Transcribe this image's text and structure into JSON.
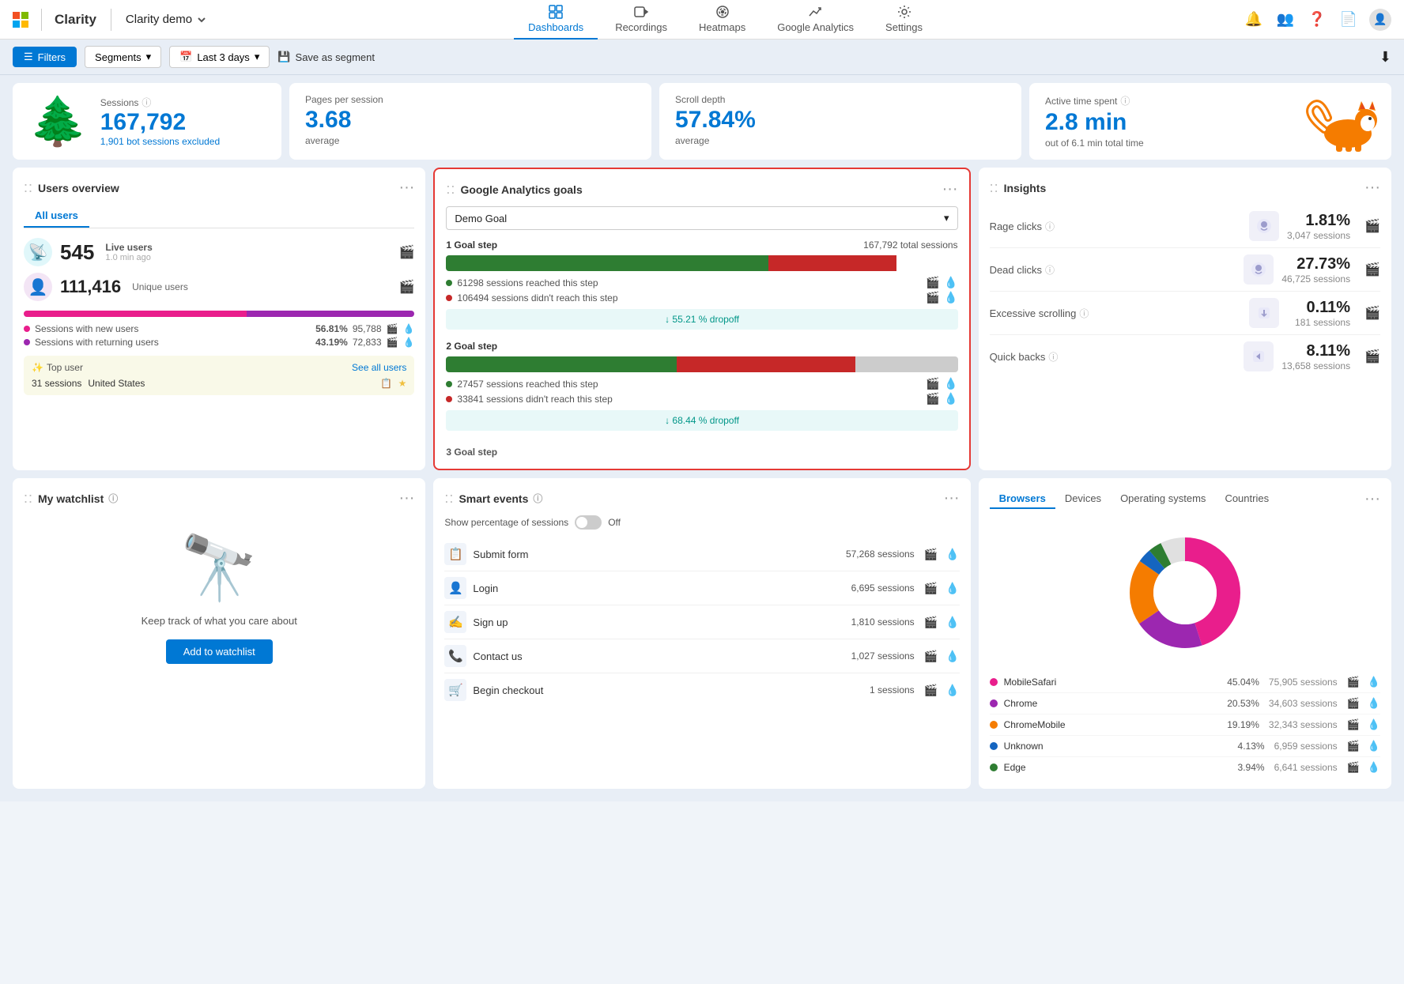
{
  "nav": {
    "brand": "Clarity",
    "project": "Clarity demo",
    "items": [
      {
        "id": "dashboards",
        "label": "Dashboards",
        "active": true
      },
      {
        "id": "recordings",
        "label": "Recordings",
        "active": false
      },
      {
        "id": "heatmaps",
        "label": "Heatmaps",
        "active": false
      },
      {
        "id": "google-analytics",
        "label": "Google Analytics",
        "active": false
      },
      {
        "id": "settings",
        "label": "Settings",
        "active": false
      }
    ]
  },
  "filterbar": {
    "filters_label": "Filters",
    "segments_label": "Segments",
    "lastdays_label": "Last 3 days",
    "save_label": "Save as segment"
  },
  "stats": {
    "sessions": {
      "label": "Sessions",
      "value": "167,792",
      "sub": "1,901 bot sessions excluded"
    },
    "pages_per_session": {
      "label": "Pages per session",
      "value": "3.68",
      "avg": "average"
    },
    "scroll_depth": {
      "label": "Scroll depth",
      "value": "57.84%",
      "avg": "average"
    },
    "active_time": {
      "label": "Active time spent",
      "value": "2.8 min",
      "sub": "out of 6.1 min total time"
    }
  },
  "users_overview": {
    "title": "Users overview",
    "tab_all_users": "All users",
    "live_users": {
      "value": "545",
      "label": "Live users",
      "sub": "1.0 min ago"
    },
    "unique_users": {
      "value": "111,416",
      "label": "Unique users"
    },
    "sessions_new": {
      "label": "Sessions with new users",
      "pct": "56.81%",
      "count": "95,788"
    },
    "sessions_returning": {
      "label": "Sessions with returning users",
      "pct": "43.19%",
      "count": "72,833"
    },
    "top_user": {
      "label": "Top user",
      "see_all": "See all users",
      "sessions": "31 sessions",
      "location": "United States"
    }
  },
  "ga_goals": {
    "title": "Google Analytics goals",
    "dropdown_value": "Demo Goal",
    "goal1": {
      "step": "1 Goal step",
      "total": "167,792 total sessions",
      "green_pct": 63,
      "red_pct": 25,
      "reached": "61298 sessions reached this step",
      "not_reached": "106494 sessions didn't reach this step",
      "dropoff": "55.21 % dropoff"
    },
    "goal2": {
      "step": "2 Goal step",
      "green_pct": 45,
      "red_pct": 35,
      "gray_pct": 20,
      "reached": "27457 sessions reached this step",
      "not_reached": "33841 sessions didn't reach this step",
      "dropoff": "68.44 % dropoff"
    },
    "goal3_label": "3 Goal step"
  },
  "insights": {
    "title": "Insights",
    "rage_clicks": {
      "label": "Rage clicks",
      "pct": "1.81%",
      "sessions": "3,047 sessions"
    },
    "dead_clicks": {
      "label": "Dead clicks",
      "pct": "27.73%",
      "sessions": "46,725 sessions"
    },
    "excessive_scrolling": {
      "label": "Excessive scrolling",
      "pct": "0.11%",
      "sessions": "181 sessions"
    },
    "quick_backs": {
      "label": "Quick backs",
      "pct": "8.11%",
      "sessions": "13,658 sessions"
    }
  },
  "watchlist": {
    "title": "My watchlist",
    "description": "Keep track of what you care about",
    "add_button": "Add to watchlist"
  },
  "smart_events": {
    "title": "Smart events",
    "toggle_label": "Show percentage of sessions",
    "toggle_value": "Off",
    "events": [
      {
        "name": "Submit form",
        "sessions": "57,268 sessions"
      },
      {
        "name": "Login",
        "sessions": "6,695 sessions"
      },
      {
        "name": "Sign up",
        "sessions": "1,810 sessions"
      },
      {
        "name": "Contact us",
        "sessions": "1,027 sessions"
      },
      {
        "name": "Begin checkout",
        "sessions": "1 sessions"
      }
    ]
  },
  "browsers": {
    "tabs": [
      "Browsers",
      "Devices",
      "Operating systems",
      "Countries"
    ],
    "active_tab": "Browsers",
    "chart": {
      "segments": [
        {
          "label": "MobileSafari",
          "pct": 45.04,
          "color": "#e91e8c"
        },
        {
          "label": "Chrome",
          "pct": 20.53,
          "color": "#9c27b0"
        },
        {
          "label": "ChromeMobile",
          "pct": 19.19,
          "color": "#f57c00"
        },
        {
          "label": "Unknown",
          "pct": 4.13,
          "color": "#1565c0"
        },
        {
          "label": "Edge",
          "pct": 3.94,
          "color": "#2e7d32"
        }
      ]
    },
    "rows": [
      {
        "name": "MobileSafari",
        "pct": "45.04%",
        "sessions": "75,905 sessions",
        "color": "#e91e8c"
      },
      {
        "name": "Chrome",
        "pct": "20.53%",
        "sessions": "34,603 sessions",
        "color": "#9c27b0"
      },
      {
        "name": "ChromeMobile",
        "pct": "19.19%",
        "sessions": "32,343 sessions",
        "color": "#f57c00"
      },
      {
        "name": "Unknown",
        "pct": "4.13%",
        "sessions": "6,959 sessions",
        "color": "#1565c0"
      },
      {
        "name": "Edge",
        "pct": "3.94%",
        "sessions": "6,641 sessions",
        "color": "#2e7d32"
      }
    ]
  }
}
